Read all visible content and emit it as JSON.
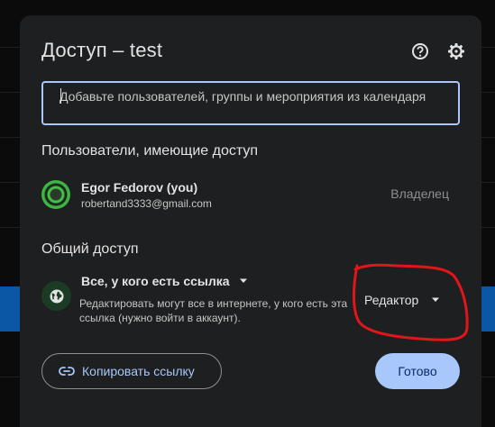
{
  "dialog": {
    "title": "Доступ – test",
    "help_icon": "help-circle-icon",
    "settings_icon": "gear-icon"
  },
  "search": {
    "placeholder": "Добавьте пользователей, группы и мероприятия из календаря"
  },
  "users_section": {
    "title": "Пользователи, имеющие доступ",
    "users": [
      {
        "name": "Egor Fedorov (you)",
        "email": "robertand3333@gmail.com",
        "role": "Владелец"
      }
    ]
  },
  "general_access": {
    "title": "Общий доступ",
    "type": "Все, у кого есть ссылка",
    "description": "Редактировать могут все в интернете, у кого есть эта ссылка (нужно войти в аккаунт).",
    "role": "Редактор",
    "icon": "globe-icon"
  },
  "footer": {
    "copy_label": "Копировать ссылку",
    "done_label": "Готово"
  },
  "colors": {
    "accent": "#a8c7fa",
    "dialog_bg": "#1e1f20",
    "annotation": "#e0161a"
  }
}
